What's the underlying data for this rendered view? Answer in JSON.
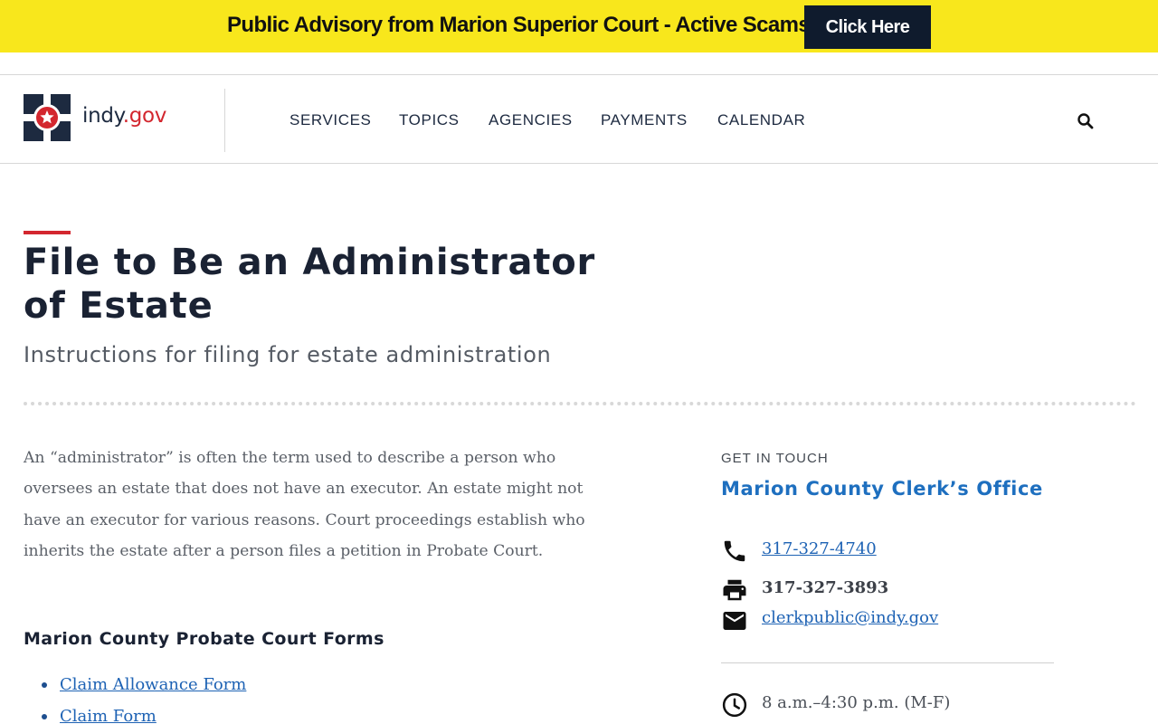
{
  "advisory": {
    "text": "Public Advisory from Marion Superior Court - Active Scams",
    "button_label": "Click Here",
    "background": "#f8e71c",
    "button_color": "#0f1b2d"
  },
  "header": {
    "logo_text_main": "indy",
    "logo_text_domain": ".gov",
    "logo_icon": "star-seal-icon",
    "nav": [
      "SERVICES",
      "TOPICS",
      "AGENCIES",
      "PAYMENTS",
      "CALENDAR"
    ],
    "search_icon": "search-icon"
  },
  "page": {
    "title": "File to Be an Administrator of Estate",
    "subtitle": "Instructions for filing for estate administration",
    "intro": "An “administrator” is often the term used to describe a person who oversees an estate that does not have an executor. An estate might not have an executor for various reasons. Court proceedings establish who inherits the estate after a person files a petition in Probate Court.",
    "forms_heading": "Marion County Probate Court Forms",
    "forms": [
      "Claim Allowance Form",
      "Claim Form"
    ]
  },
  "contact": {
    "label": "GET IN TOUCH",
    "office": "Marion County Clerk’s Office",
    "phone": "317-327-4740",
    "fax": "317-327-3893",
    "email": "clerkpublic@indy.gov",
    "hours": "8 a.m.–4:30 p.m. (M-F)",
    "icons": [
      "phone-icon",
      "fax-icon",
      "email-icon",
      "clock-icon"
    ]
  },
  "colors": {
    "accent_red": "#d3272f",
    "link_blue": "#1d62b4",
    "navy": "#1d2a40"
  }
}
